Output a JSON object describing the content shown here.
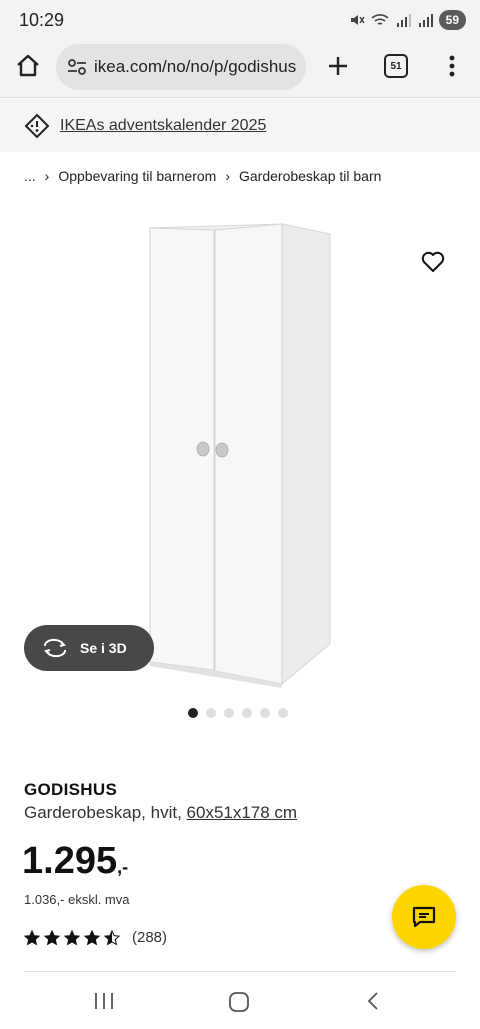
{
  "status": {
    "time": "10:29",
    "battery": "59"
  },
  "browser": {
    "url": "ikea.com/no/no/p/godishus",
    "tab_count": "51"
  },
  "promo": {
    "link": "IKEAs adventskalender 2025"
  },
  "breadcrumb": {
    "ellipsis": "...",
    "items": [
      "Oppbevaring til barnerom",
      "Garderobeskap til barn"
    ]
  },
  "gallery": {
    "view3d_label": "Se i 3D",
    "dot_count": 6,
    "active_dot": 0
  },
  "product": {
    "name": "GODISHUS",
    "description": "Garderobeskap, hvit, ",
    "size": "60x51x178 cm",
    "price": "1.295",
    "price_suffix": ",-",
    "price_ex_vat": "1.036,- ekskl. mva",
    "rating_value": 4.5,
    "rating_count": "(288)"
  },
  "colors": {
    "accent_yellow": "#ffd500",
    "dark_button": "#484848"
  },
  "icons": [
    "home-icon",
    "site-settings-icon",
    "plus-icon",
    "tabs-icon",
    "more-icon",
    "promo-tag-icon",
    "heart-icon",
    "rotate-3d-icon",
    "star-icon",
    "chat-icon",
    "recent-apps-icon",
    "home-nav-icon",
    "back-icon"
  ]
}
